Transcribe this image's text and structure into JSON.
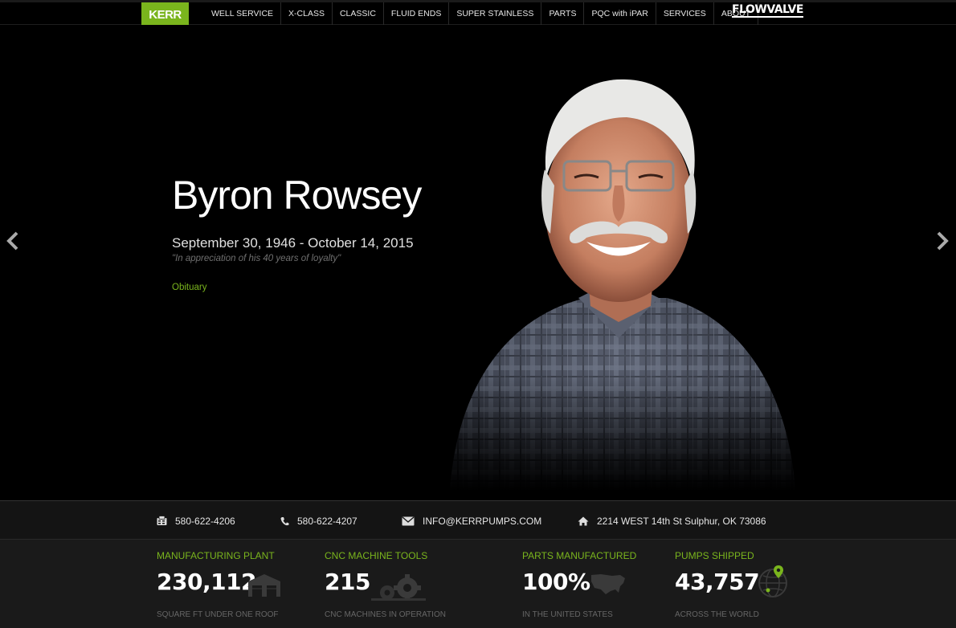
{
  "nav": {
    "logo": "KERR",
    "items": [
      {
        "label": "WELL SERVICE"
      },
      {
        "label": "X-CLASS"
      },
      {
        "label": "CLASSIC"
      },
      {
        "label": "FLUID ENDS"
      },
      {
        "label": "SUPER STAINLESS"
      },
      {
        "label": "PARTS"
      },
      {
        "label": "PQC with iPAR"
      },
      {
        "label": "SERVICES"
      },
      {
        "label": "ABOUT"
      }
    ],
    "partner_logo": "FLOWVALVE"
  },
  "hero": {
    "name": "Byron Rowsey",
    "dates": "September 30, 1946 - October 14, 2015",
    "quote": "\"In appreciation of his 40 years of loyalty\"",
    "link": "Obituary"
  },
  "contact": {
    "fax": "580-622-4206",
    "phone": "580-622-4207",
    "email": "INFO@KERRPUMPS.COM",
    "address": "2214 WEST 14th St Sulphur, OK 73086"
  },
  "stats": [
    {
      "title": "MANUFACTURING PLANT",
      "value": "230,112",
      "sub": "SQUARE FT UNDER ONE ROOF",
      "icon": "warehouse-icon"
    },
    {
      "title": "CNC MACHINE TOOLS",
      "value": "215",
      "sub": "CNC MACHINES IN OPERATION",
      "icon": "gears-icon"
    },
    {
      "title": "PARTS MANUFACTURED",
      "value": "100%",
      "sub": "IN THE UNITED STATES",
      "icon": "usa-map-icon"
    },
    {
      "title": "PUMPS SHIPPED",
      "value": "43,757",
      "sub": "ACROSS THE WORLD",
      "icon": "globe-pin-icon"
    }
  ],
  "colors": {
    "accent": "#7ab51d",
    "background": "#000000",
    "bar": "#141414"
  }
}
